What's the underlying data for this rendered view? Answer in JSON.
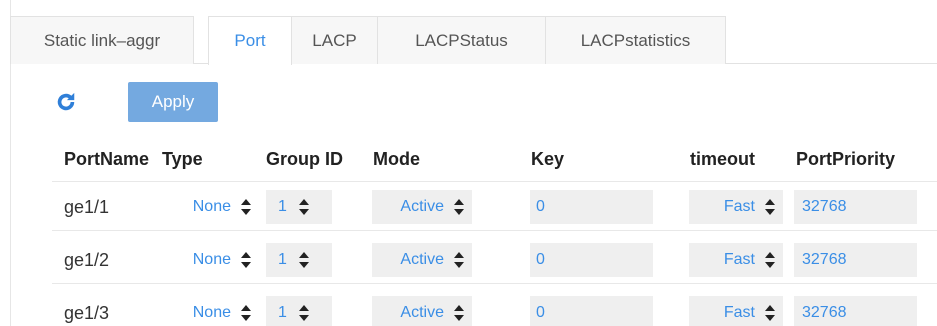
{
  "tabs": [
    {
      "label": "Static link–aggr",
      "active": false
    },
    {
      "label": "Port",
      "active": true
    },
    {
      "label": "LACP",
      "active": false
    },
    {
      "label": "LACPStatus",
      "active": false
    },
    {
      "label": "LACPstatistics",
      "active": false
    }
  ],
  "toolbar": {
    "refresh_icon": "refresh-icon",
    "apply_label": "Apply"
  },
  "table": {
    "columns": [
      "PortName",
      "Type",
      "Group ID",
      "Mode",
      "Key",
      "timeout",
      "PortPriority"
    ],
    "rows": [
      {
        "port": "ge1/1",
        "type": "None",
        "group_id": "1",
        "mode": "Active",
        "key": "0",
        "timeout": "Fast",
        "priority": "32768"
      },
      {
        "port": "ge1/2",
        "type": "None",
        "group_id": "1",
        "mode": "Active",
        "key": "0",
        "timeout": "Fast",
        "priority": "32768"
      },
      {
        "port": "ge1/3",
        "type": "None",
        "group_id": "1",
        "mode": "Active",
        "key": "0",
        "timeout": "Fast",
        "priority": "32768"
      }
    ]
  },
  "colors": {
    "accent": "#3a8ee6",
    "apply_bg": "#74a9e0",
    "field_bg": "#efefef"
  }
}
